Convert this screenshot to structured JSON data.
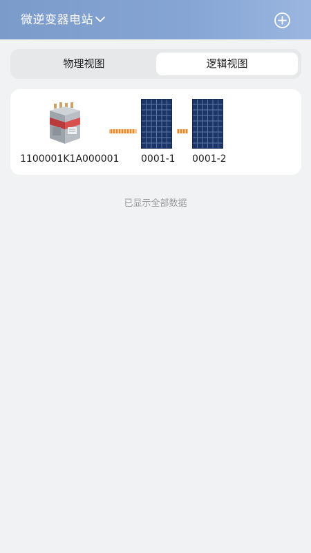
{
  "header": {
    "station_name": "微逆变器电站",
    "icons": {
      "dropdown": "chevron-down-icon",
      "add": "plus-circle-icon"
    }
  },
  "view_tabs": [
    {
      "label": "物理视图",
      "selected": false
    },
    {
      "label": "逻辑视图",
      "selected": true
    }
  ],
  "topology": {
    "inverter": {
      "label": "1100001K1A000001",
      "icon": "micro-inverter-icon"
    },
    "panels": [
      {
        "label": "0001-1",
        "icon": "solar-panel-icon"
      },
      {
        "label": "0001-2",
        "icon": "solar-panel-icon"
      }
    ]
  },
  "status_text": "已显示全部数据",
  "colors": {
    "header_gradient_start": "#7b9bcb",
    "header_gradient_end": "#9ab6e0",
    "panel_fill": "#1d3566",
    "connector": "#f0a049",
    "inverter_red": "#d8504f"
  }
}
